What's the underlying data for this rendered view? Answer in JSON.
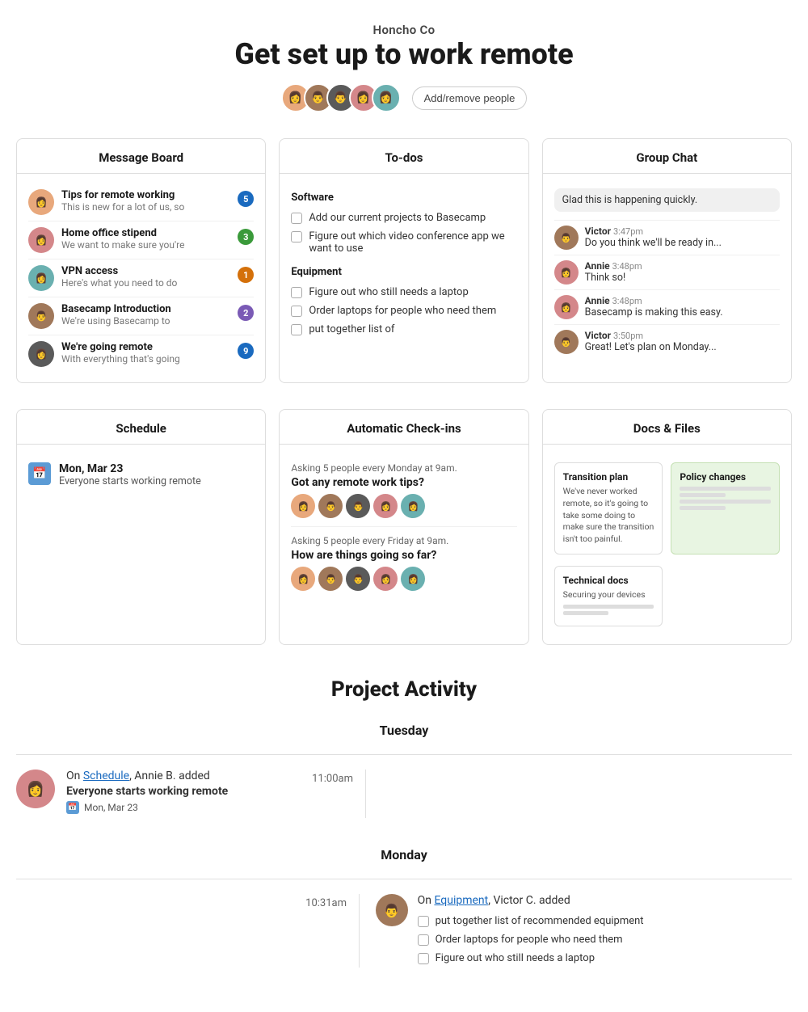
{
  "header": {
    "company": "Honcho Co",
    "title": "Get set up to work remote",
    "add_people_label": "Add/remove people"
  },
  "message_board": {
    "title": "Message Board",
    "items": [
      {
        "title": "Tips for remote working",
        "preview": "This is new for a lot of us, so",
        "badge": "5",
        "badge_color": "badge-blue"
      },
      {
        "title": "Home office stipend",
        "preview": "We want to make sure you're",
        "badge": "3",
        "badge_color": "badge-green"
      },
      {
        "title": "VPN access",
        "preview": "Here's what you need to do",
        "badge": "1",
        "badge_color": "badge-orange"
      },
      {
        "title": "Basecamp Introduction",
        "preview": "We're using Basecamp to",
        "badge": "2",
        "badge_color": "badge-purple"
      },
      {
        "title": "We're going remote",
        "preview": "With everything that's going",
        "badge": "9",
        "badge_color": "badge-blue"
      }
    ]
  },
  "todos": {
    "title": "To-dos",
    "sections": [
      {
        "name": "Software",
        "items": [
          "Add our current projects to Basecamp",
          "Figure out which video conference app we want to use"
        ]
      },
      {
        "name": "Equipment",
        "items": [
          "Figure out who still needs a laptop",
          "Order laptops for people who need them",
          "put together list of"
        ]
      }
    ]
  },
  "group_chat": {
    "title": "Group Chat",
    "messages": [
      {
        "type": "bubble",
        "text": "Glad this is happening quickly."
      },
      {
        "type": "avatar",
        "name": "Victor",
        "time": "3:47pm",
        "text": "Do you think we'll be ready in...",
        "av_class": "av-brown"
      },
      {
        "type": "avatar",
        "name": "Annie",
        "time": "3:48pm",
        "text": "Think so!",
        "av_class": "av-pink"
      },
      {
        "type": "avatar",
        "name": "Annie",
        "time": "3:48pm",
        "text": "Basecamp is making this easy.",
        "av_class": "av-pink"
      },
      {
        "type": "avatar",
        "name": "Victor",
        "time": "3:50pm",
        "text": "Great! Let's plan on Monday...",
        "av_class": "av-brown"
      }
    ]
  },
  "schedule": {
    "title": "Schedule",
    "events": [
      {
        "date": "Mon, Mar 23",
        "description": "Everyone starts working remote"
      }
    ]
  },
  "checkins": {
    "title": "Automatic Check-ins",
    "items": [
      {
        "frequency": "Asking 5 people every Monday at 9am.",
        "question": "Got any remote work tips?"
      },
      {
        "frequency": "Asking 5 people every Friday at 9am.",
        "question": "How are things going so far?"
      }
    ]
  },
  "docs": {
    "title": "Docs & Files",
    "cards": [
      {
        "title": "Transition plan",
        "body": "We've never worked remote, so it's going to take some doing to make sure the transition isn't too painful.",
        "style": "normal"
      },
      {
        "title": "Policy changes",
        "body": "",
        "style": "green"
      },
      {
        "title": "Technical docs",
        "body": "Securing your devices",
        "style": "normal full"
      }
    ]
  },
  "activity": {
    "title": "Project Activity",
    "days": [
      {
        "label": "Tuesday",
        "entries": [
          {
            "time": "11:00am",
            "actor": "Annie B.",
            "action_prefix": "On",
            "action_link": "Schedule",
            "action_suffix": ", Annie B. added",
            "event_title": "Everyone starts working remote",
            "sub_date": "Mon, Mar 23",
            "av_class": "av-pink"
          }
        ]
      },
      {
        "label": "Monday",
        "entries": [
          {
            "time": "10:31am",
            "actor": "Victor C.",
            "action_prefix": "On",
            "action_link": "Equipment",
            "action_suffix": ", Victor C. added",
            "todos": [
              "put together list of recommended equipment",
              "Order laptops for people who need them",
              "Figure out who still needs a laptop"
            ],
            "av_class": "av-brown"
          }
        ]
      }
    ]
  }
}
